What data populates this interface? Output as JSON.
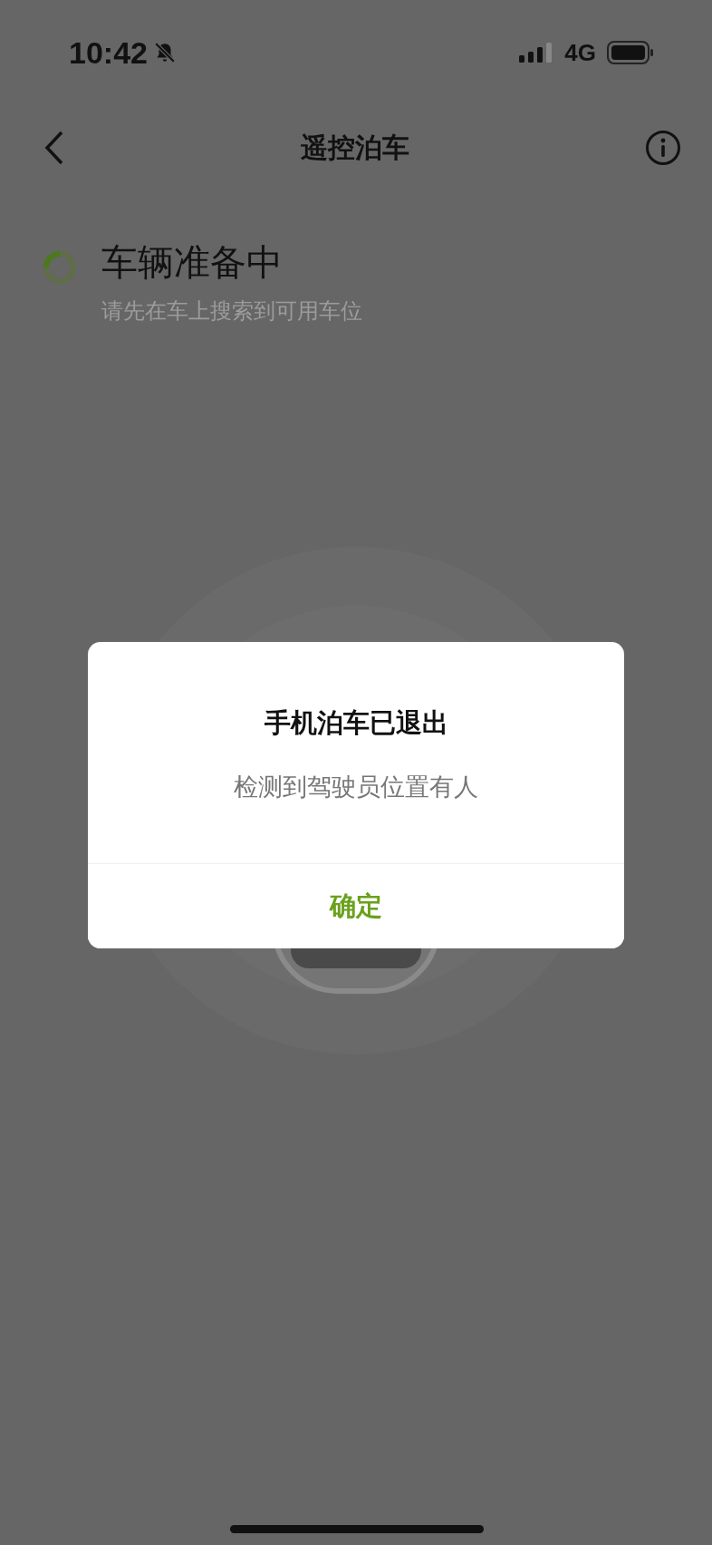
{
  "status_bar": {
    "time": "10:42",
    "network": "4G"
  },
  "header": {
    "title": "遥控泊车"
  },
  "vehicle_status": {
    "title": "车辆准备中",
    "subtitle": "请先在车上搜索到可用车位"
  },
  "dialog": {
    "title": "手机泊车已退出",
    "message": "检测到驾驶员位置有人",
    "button": "确定"
  }
}
